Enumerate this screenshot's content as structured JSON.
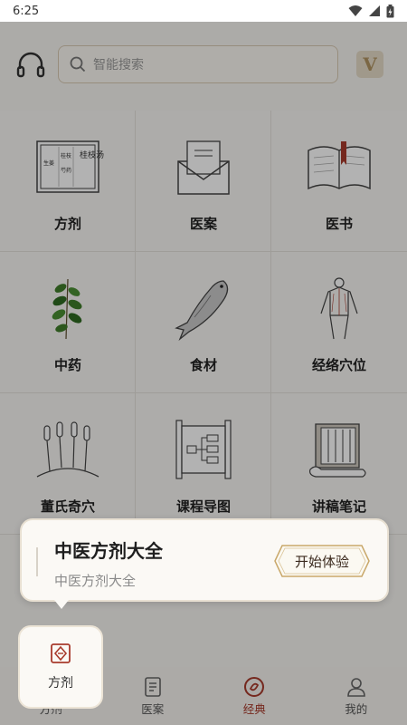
{
  "status": {
    "time": "6:25"
  },
  "search": {
    "placeholder": "智能搜索"
  },
  "vip": {
    "label": "V"
  },
  "grid": [
    {
      "label": "方剂",
      "icon": "formula-scroll-icon",
      "scroll_text": [
        "桂枝汤",
        "桂枝",
        "芍药",
        "生姜"
      ]
    },
    {
      "label": "医案",
      "icon": "envelope-icon"
    },
    {
      "label": "医书",
      "icon": "open-book-icon"
    },
    {
      "label": "中药",
      "icon": "herb-plant-icon"
    },
    {
      "label": "食材",
      "icon": "fish-icon"
    },
    {
      "label": "经络穴位",
      "icon": "meridian-body-icon"
    },
    {
      "label": "董氏奇穴",
      "icon": "acupuncture-needles-icon"
    },
    {
      "label": "课程导图",
      "icon": "mindmap-scroll-icon"
    },
    {
      "label": "讲稿笔记",
      "icon": "notebook-scroll-icon"
    }
  ],
  "popup": {
    "title": "中医方剂大全",
    "subtitle": "中医方剂大全",
    "button": "开始体验"
  },
  "highlight": {
    "label": "方剂"
  },
  "tabs": [
    {
      "label": "方剂",
      "icon": "formula-icon"
    },
    {
      "label": "医案",
      "icon": "document-icon"
    },
    {
      "label": "经典",
      "icon": "classic-icon",
      "active": true
    },
    {
      "label": "我的",
      "icon": "profile-icon"
    }
  ],
  "colors": {
    "accent": "#a83a2c",
    "border_gold": "#d9cbb4"
  }
}
